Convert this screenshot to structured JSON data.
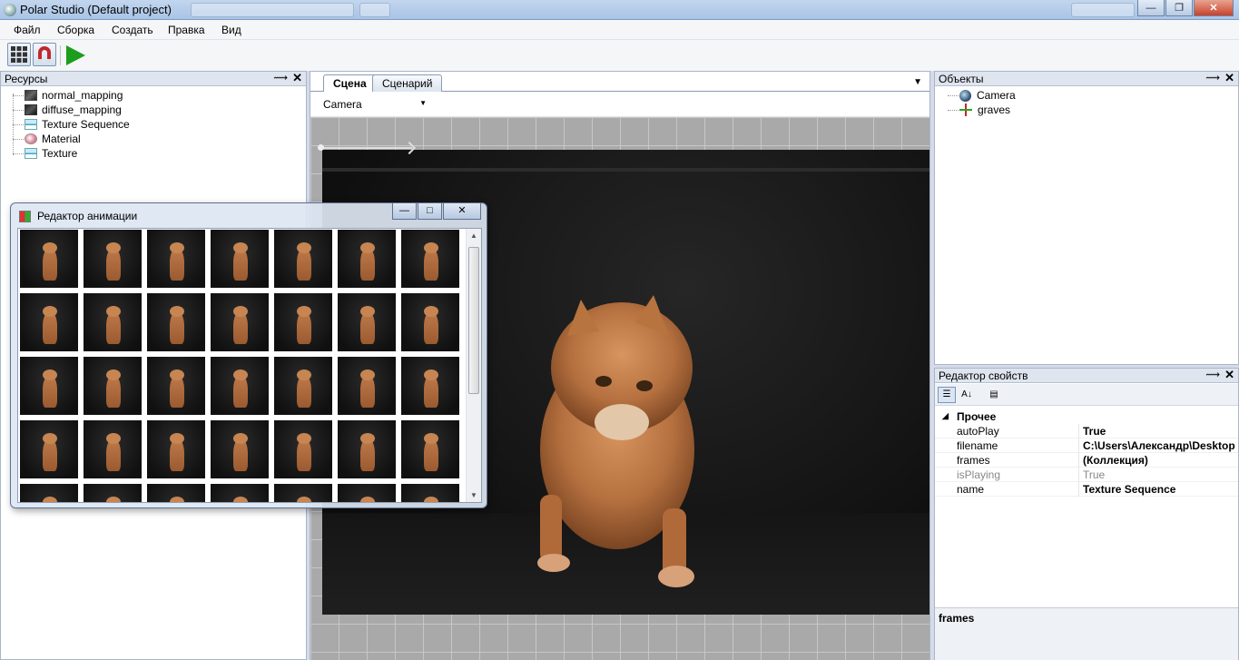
{
  "window": {
    "title": "Polar Studio (Default project)"
  },
  "menu": [
    "Файл",
    "Сборка",
    "Создать",
    "Правка",
    "Вид"
  ],
  "toolbar": {
    "grid_icon": "grid-icon",
    "magnet_icon": "magnet-icon",
    "play_icon": "play-icon",
    "play_color": "#1b9e1b"
  },
  "resources": {
    "title": "Ресурсы",
    "items": [
      {
        "label": "normal_mapping",
        "icon": "texture-dark-icon"
      },
      {
        "label": "diffuse_mapping",
        "icon": "texture-dark-icon"
      },
      {
        "label": "Texture Sequence",
        "icon": "texture-sequence-icon"
      },
      {
        "label": "Material",
        "icon": "material-icon"
      },
      {
        "label": "Texture",
        "icon": "texture-icon"
      }
    ]
  },
  "document": {
    "tabs": [
      {
        "label": "Сцена",
        "active": true
      },
      {
        "label": "Сценарий",
        "active": false
      }
    ],
    "camera_select": "Camera"
  },
  "objects": {
    "title": "Объекты",
    "items": [
      {
        "label": "Camera",
        "icon": "camera-icon"
      },
      {
        "label": "graves",
        "icon": "axes-icon"
      }
    ]
  },
  "properties": {
    "title": "Редактор свойств",
    "category": "Прочее",
    "rows": [
      {
        "name": "autoPlay",
        "value": "True",
        "bold": true,
        "gray": false
      },
      {
        "name": "filename",
        "value": "C:\\Users\\Александр\\Desktop",
        "bold": true,
        "gray": false
      },
      {
        "name": "frames",
        "value": "(Коллекция)",
        "bold": true,
        "gray": false
      },
      {
        "name": "isPlaying",
        "value": "True",
        "bold": false,
        "gray": true
      },
      {
        "name": "name",
        "value": "Texture Sequence",
        "bold": true,
        "gray": false
      }
    ],
    "description_title": "frames"
  },
  "animation_editor": {
    "title": "Редактор анимации",
    "frame_rows": 5,
    "frame_cols": 7
  }
}
